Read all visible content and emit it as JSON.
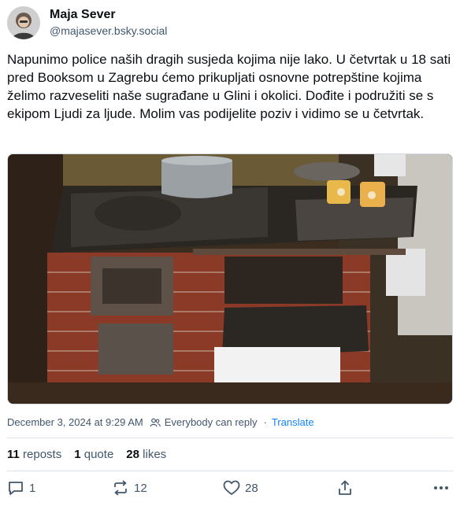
{
  "author": {
    "display_name": "Maja Sever",
    "handle": "@majasever.bsky.social",
    "avatar_icon": "avatar-photo"
  },
  "post": {
    "text": "Napunimo police naših dragih susjeda kojima nije lako. U četvrtak u 18 sati pred Booksom u Zagrebu ćemo prikupljati osnovne potrepštine kojima želimo razveseliti naše sugrađane u Glini i okolici. Dođite i podružiti se s ekipom Ljudi za ljude. Molim vas podijelite poziv i vidimo se u četvrtak.",
    "image_icon": "photo-wood-stove"
  },
  "meta": {
    "timestamp": "December 3, 2024 at 9:29 AM",
    "reply_setting": "Everybody can reply",
    "separator": "·",
    "translate_label": "Translate"
  },
  "stats": {
    "reposts_count": "11",
    "reposts_label": "reposts",
    "quotes_count": "1",
    "quotes_label": "quote",
    "likes_count": "28",
    "likes_label": "likes"
  },
  "actions": {
    "reply_count": "1",
    "repost_count": "12",
    "like_count": "28",
    "reply_icon": "reply-icon",
    "repost_icon": "repost-icon",
    "like_icon": "heart-icon",
    "share_icon": "share-icon",
    "more_icon": "more-icon"
  },
  "colors": {
    "text": "#0b0f14",
    "muted": "#42576c",
    "link": "#1083fe",
    "divider": "#dce2ea"
  }
}
